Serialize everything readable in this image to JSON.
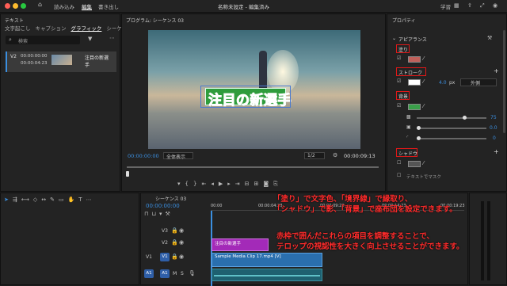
{
  "topbar": {
    "menu_home": "⌂",
    "menu_import": "読み込み",
    "menu_edit": "編集",
    "menu_export": "書き出し",
    "title": "名称未設定 - 編集済み",
    "right_a": "学習",
    "colors": {
      "close": "#ff5f57",
      "min": "#febc2e",
      "max": "#28c840"
    }
  },
  "left": {
    "panel_title": "テキスト",
    "tabs": [
      "文字起こし",
      "キャプション",
      "グラフィック",
      "シーケ"
    ],
    "active_tab": "グラフィック",
    "search_placeholder": "検索",
    "item": {
      "track": "V2",
      "time_in": "00:00:00:00",
      "time_out": "00:00:04:23",
      "name_l1": "注目の新選",
      "name_l2": "手"
    }
  },
  "program": {
    "title": "プログラム: シーケンス 03",
    "video_caption": "注目の新選手",
    "timecode": "00:00:00:00",
    "fit": "全体表示",
    "ratio": "1/2",
    "duration": "00:00:09:13"
  },
  "props": {
    "title": "プロパティ",
    "section": "アピアランス",
    "fill": "塗り",
    "stroke": "ストローク",
    "stroke_width": "4.0",
    "stroke_unit": "px",
    "stroke_pos": "外側",
    "background": "背景",
    "bg_val1": "75",
    "bg_val2": "0.0",
    "bg_val3": "0",
    "shadow": "シャドウ",
    "textmask": "テキストでマスク",
    "colors": {
      "fill": "#c0605a",
      "stroke": "#ffffff",
      "bg": "#3aa04a",
      "shadow": "#555555"
    }
  },
  "timeline": {
    "title": "シーケンス 03",
    "timecode": "00:00:00:00",
    "ruler": [
      "00:00",
      "00:00:04:23",
      "00:00:09:23",
      "00:00:14:23",
      "00:00:19:23"
    ],
    "tracks": [
      {
        "a": "V3"
      },
      {
        "a": "V2"
      },
      {
        "a": "V1",
        "b": "V1"
      },
      {
        "a": "A1",
        "b": "A1"
      }
    ],
    "clip_text": "注目の新選手",
    "clip_video": "Sample Media Clip 17.mp4 [V]"
  },
  "annotation": {
    "line1": "「塗り」で文字色、「境界線」で縁取り、",
    "line2": "「シャドウ」で影、「背景」で座布団を設定できます。",
    "line3": "赤枠で囲んだこれらの項目を調整することで、",
    "line4": "テロップの視認性を大きく向上させることができます。"
  }
}
